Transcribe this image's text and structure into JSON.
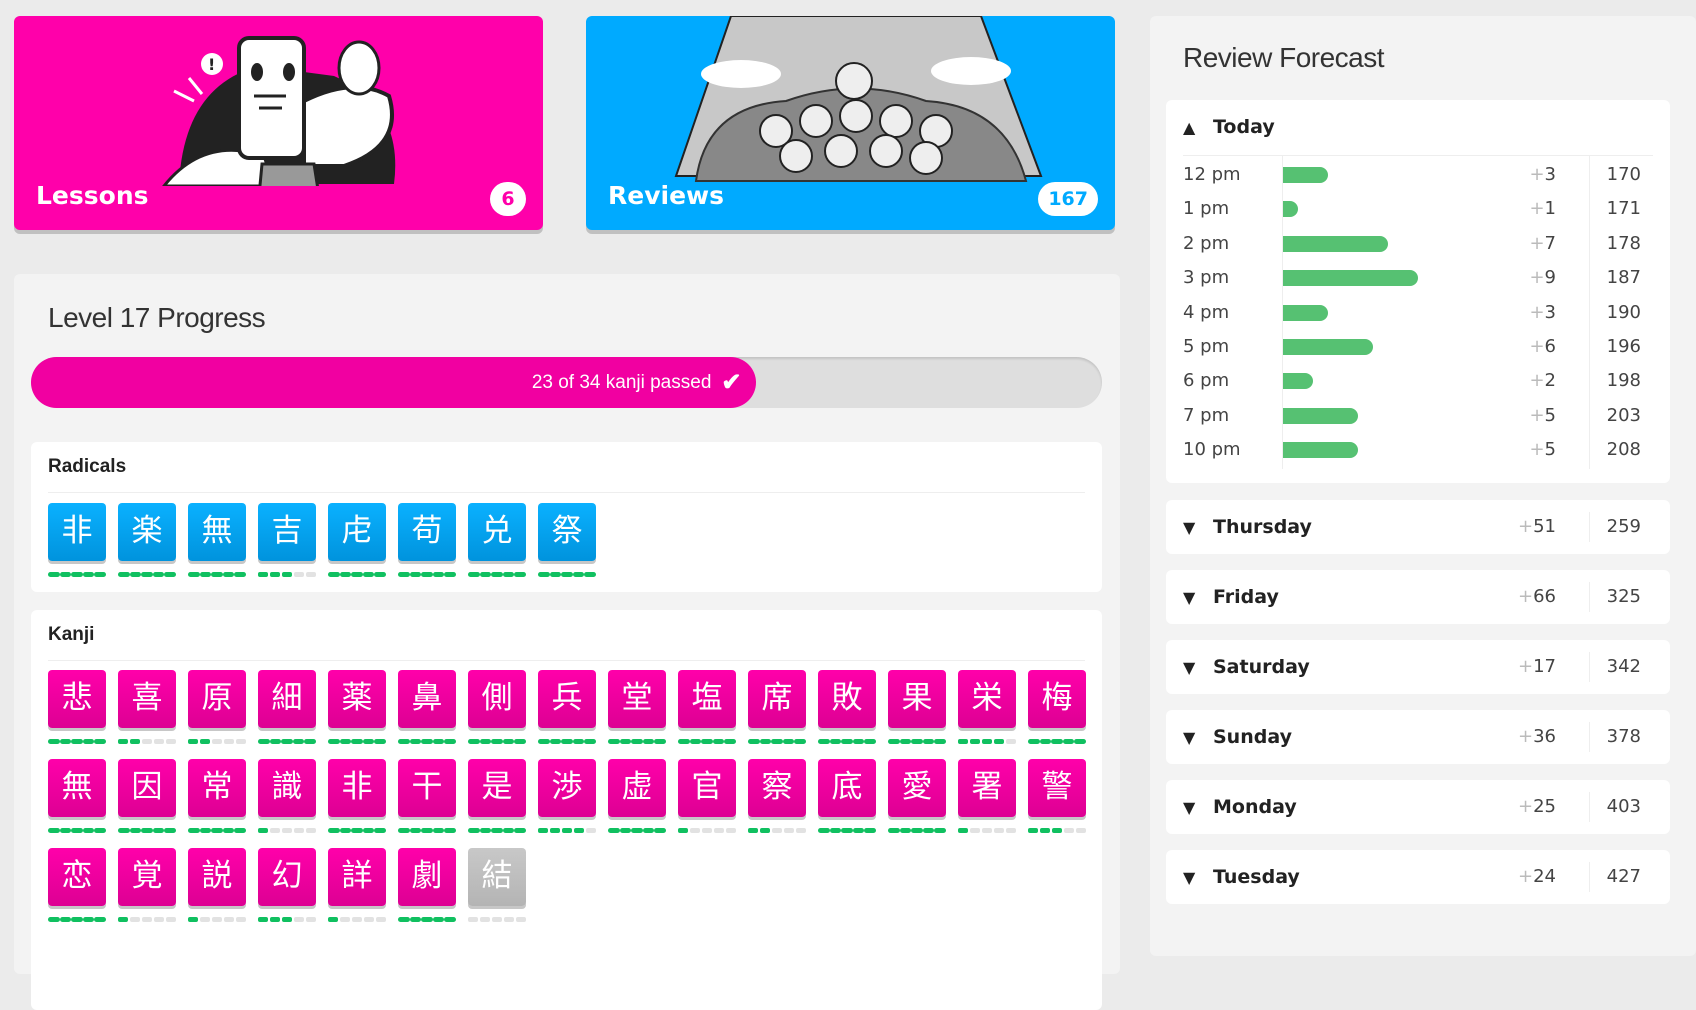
{
  "lessons": {
    "label": "Lessons",
    "count": "6",
    "illustration": "crabigator-with-turtle-illustration"
  },
  "reviews": {
    "label": "Reviews",
    "count": "167",
    "illustration": "crowd-of-turtles-illustration"
  },
  "level_progress": {
    "title": "Level 17 Progress",
    "progress_text": "23 of 34 kanji passed",
    "passed": 23,
    "total": 34,
    "check_icon": "✔",
    "radicals_header": "Radicals",
    "kanji_header": "Kanji",
    "radicals": [
      {
        "char": "非",
        "srs": 5
      },
      {
        "char": "楽",
        "srs": 5
      },
      {
        "char": "無",
        "srs": 5
      },
      {
        "char": "吉",
        "srs": 3
      },
      {
        "char": "虍",
        "srs": 5
      },
      {
        "char": "苟",
        "srs": 5
      },
      {
        "char": "兑",
        "srs": 5
      },
      {
        "char": "祭",
        "srs": 5
      }
    ],
    "kanji": [
      {
        "char": "悲",
        "srs": 5
      },
      {
        "char": "喜",
        "srs": 2
      },
      {
        "char": "原",
        "srs": 2
      },
      {
        "char": "細",
        "srs": 5
      },
      {
        "char": "薬",
        "srs": 5
      },
      {
        "char": "鼻",
        "srs": 5
      },
      {
        "char": "側",
        "srs": 5
      },
      {
        "char": "兵",
        "srs": 5
      },
      {
        "char": "堂",
        "srs": 5
      },
      {
        "char": "塩",
        "srs": 5
      },
      {
        "char": "席",
        "srs": 5
      },
      {
        "char": "敗",
        "srs": 5
      },
      {
        "char": "果",
        "srs": 5
      },
      {
        "char": "栄",
        "srs": 4
      },
      {
        "char": "梅",
        "srs": 5
      },
      {
        "char": "無",
        "srs": 5
      },
      {
        "char": "因",
        "srs": 5
      },
      {
        "char": "常",
        "srs": 5
      },
      {
        "char": "識",
        "srs": 1
      },
      {
        "char": "非",
        "srs": 5
      },
      {
        "char": "干",
        "srs": 5
      },
      {
        "char": "是",
        "srs": 5
      },
      {
        "char": "渉",
        "srs": 4
      },
      {
        "char": "虚",
        "srs": 5
      },
      {
        "char": "官",
        "srs": 1
      },
      {
        "char": "察",
        "srs": 2
      },
      {
        "char": "底",
        "srs": 5
      },
      {
        "char": "愛",
        "srs": 5
      },
      {
        "char": "署",
        "srs": 1
      },
      {
        "char": "警",
        "srs": 3
      },
      {
        "char": "恋",
        "srs": 5
      },
      {
        "char": "覚",
        "srs": 1
      },
      {
        "char": "説",
        "srs": 1
      },
      {
        "char": "幻",
        "srs": 3
      },
      {
        "char": "詳",
        "srs": 1
      },
      {
        "char": "劇",
        "srs": 5
      },
      {
        "char": "結",
        "srs": 0,
        "locked": true
      }
    ]
  },
  "forecast": {
    "title": "Review Forecast",
    "today": {
      "label": "Today",
      "expanded": true,
      "rows": [
        {
          "time": "12 pm",
          "delta": 3,
          "total": "170"
        },
        {
          "time": "1 pm",
          "delta": 1,
          "total": "171"
        },
        {
          "time": "2 pm",
          "delta": 7,
          "total": "178"
        },
        {
          "time": "3 pm",
          "delta": 9,
          "total": "187"
        },
        {
          "time": "4 pm",
          "delta": 3,
          "total": "190"
        },
        {
          "time": "5 pm",
          "delta": 6,
          "total": "196"
        },
        {
          "time": "6 pm",
          "delta": 2,
          "total": "198"
        },
        {
          "time": "7 pm",
          "delta": 5,
          "total": "203"
        },
        {
          "time": "10 pm",
          "delta": 5,
          "total": "208"
        }
      ]
    },
    "days": [
      {
        "label": "Thursday",
        "delta": "51",
        "total": "259"
      },
      {
        "label": "Friday",
        "delta": "66",
        "total": "325"
      },
      {
        "label": "Saturday",
        "delta": "17",
        "total": "342"
      },
      {
        "label": "Sunday",
        "delta": "36",
        "total": "378"
      },
      {
        "label": "Monday",
        "delta": "25",
        "total": "403"
      },
      {
        "label": "Tuesday",
        "delta": "24",
        "total": "427"
      }
    ],
    "chevron_up": "⌃",
    "chevron_down": "⌄",
    "bar_color": "#56c172"
  },
  "colors": {
    "lesson_pink": "#ff00aa",
    "review_blue": "#00aaff",
    "srs_green": "#10c060",
    "locked_gray": "#c0c0c0"
  }
}
